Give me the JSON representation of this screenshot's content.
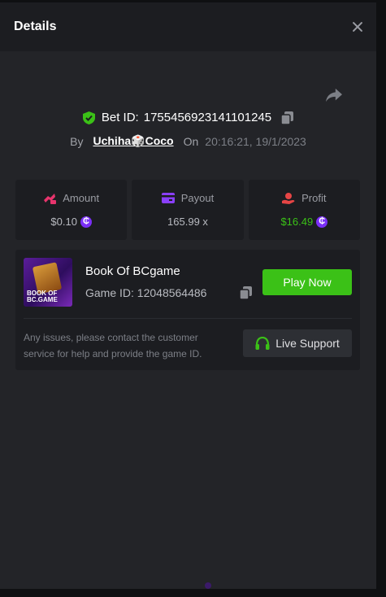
{
  "header": {
    "title": "Details"
  },
  "bet": {
    "label": "Bet ID:",
    "id": "1755456923141101245",
    "by_label": "By",
    "user": "Uchiha🎲Coco",
    "on_label": "On",
    "time": "20:16:21, 19/1/2023"
  },
  "stats": {
    "amount": {
      "label": "Amount",
      "value": "$0.10"
    },
    "payout": {
      "label": "Payout",
      "value": "165.99 x"
    },
    "profit": {
      "label": "Profit",
      "value": "$16.49"
    }
  },
  "coin_symbol": "₵",
  "game": {
    "name": "Book Of BCgame",
    "id_text": "Game ID: 12048564486",
    "thumb_text_1": "BOOK OF",
    "thumb_text_2": "BC.GAME",
    "play_label": "Play Now"
  },
  "support": {
    "text": "Any issues, please contact the customer service for help and provide the game ID.",
    "button_label": "Live Support"
  },
  "colors": {
    "accent_green": "#3bc117",
    "coin_purple": "#7b2ff7",
    "amount_pink": "#e8346d",
    "payout_purple": "#8a3ffc",
    "profit_red": "#e64545"
  }
}
